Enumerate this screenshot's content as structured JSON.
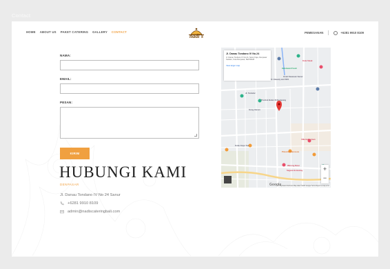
{
  "window": {
    "title": "Contact"
  },
  "nav": {
    "menu": [
      "HOME",
      "ABOUT US",
      "PAKET CATERING",
      "GALLERY",
      "CONTACT"
    ],
    "logo_text": "nadi's",
    "order_label": "PEMESANAN",
    "phone": "+6281 9910 8109"
  },
  "form": {
    "name_label": "NAMA:",
    "email_label": "EMAIL:",
    "message_label": "PESAN:",
    "name_value": "",
    "email_value": "",
    "message_value": "",
    "submit_label": "KIRIM"
  },
  "contact": {
    "heading": "HUBUNGI KAMI",
    "category": "DENPASAR",
    "address": "Jl. Danau Tondano IV No 24 Sanur",
    "phone": "+6281 9910 8109",
    "email": "admin@nadiscateringbali.com"
  },
  "map": {
    "place_title": "Jl. Danau Tondano IV No.24",
    "place_address": "Jl. Danau Tondano IV No.24, Sanur Kaja, Denpasar Selatan, Kota Denpasar, Bali 80228",
    "view_larger": "View larger map",
    "labels": [
      "Indomaret Fresh",
      "Kuta Steak",
      "Hotel Kawasan Sanur",
      "OASIS 1 Beauty and SPA",
      "Jl. Tantular",
      "Pondok Bulan Ni Kompang",
      "Gang Harum",
      "Kubu Kaya Tua",
      "Pizzeria Francesca",
      "Villa bakterman",
      "Warung Dewi",
      "Segara Homestay"
    ],
    "zoom_in": "+",
    "zoom_out": "−",
    "google": "Google",
    "attribution": "Keyboard shortcuts  Map data ©2023 Google  Terms  Report a map error"
  },
  "colors": {
    "accent": "#f0a040",
    "background": "#ebebeb",
    "card": "#ffffff"
  }
}
